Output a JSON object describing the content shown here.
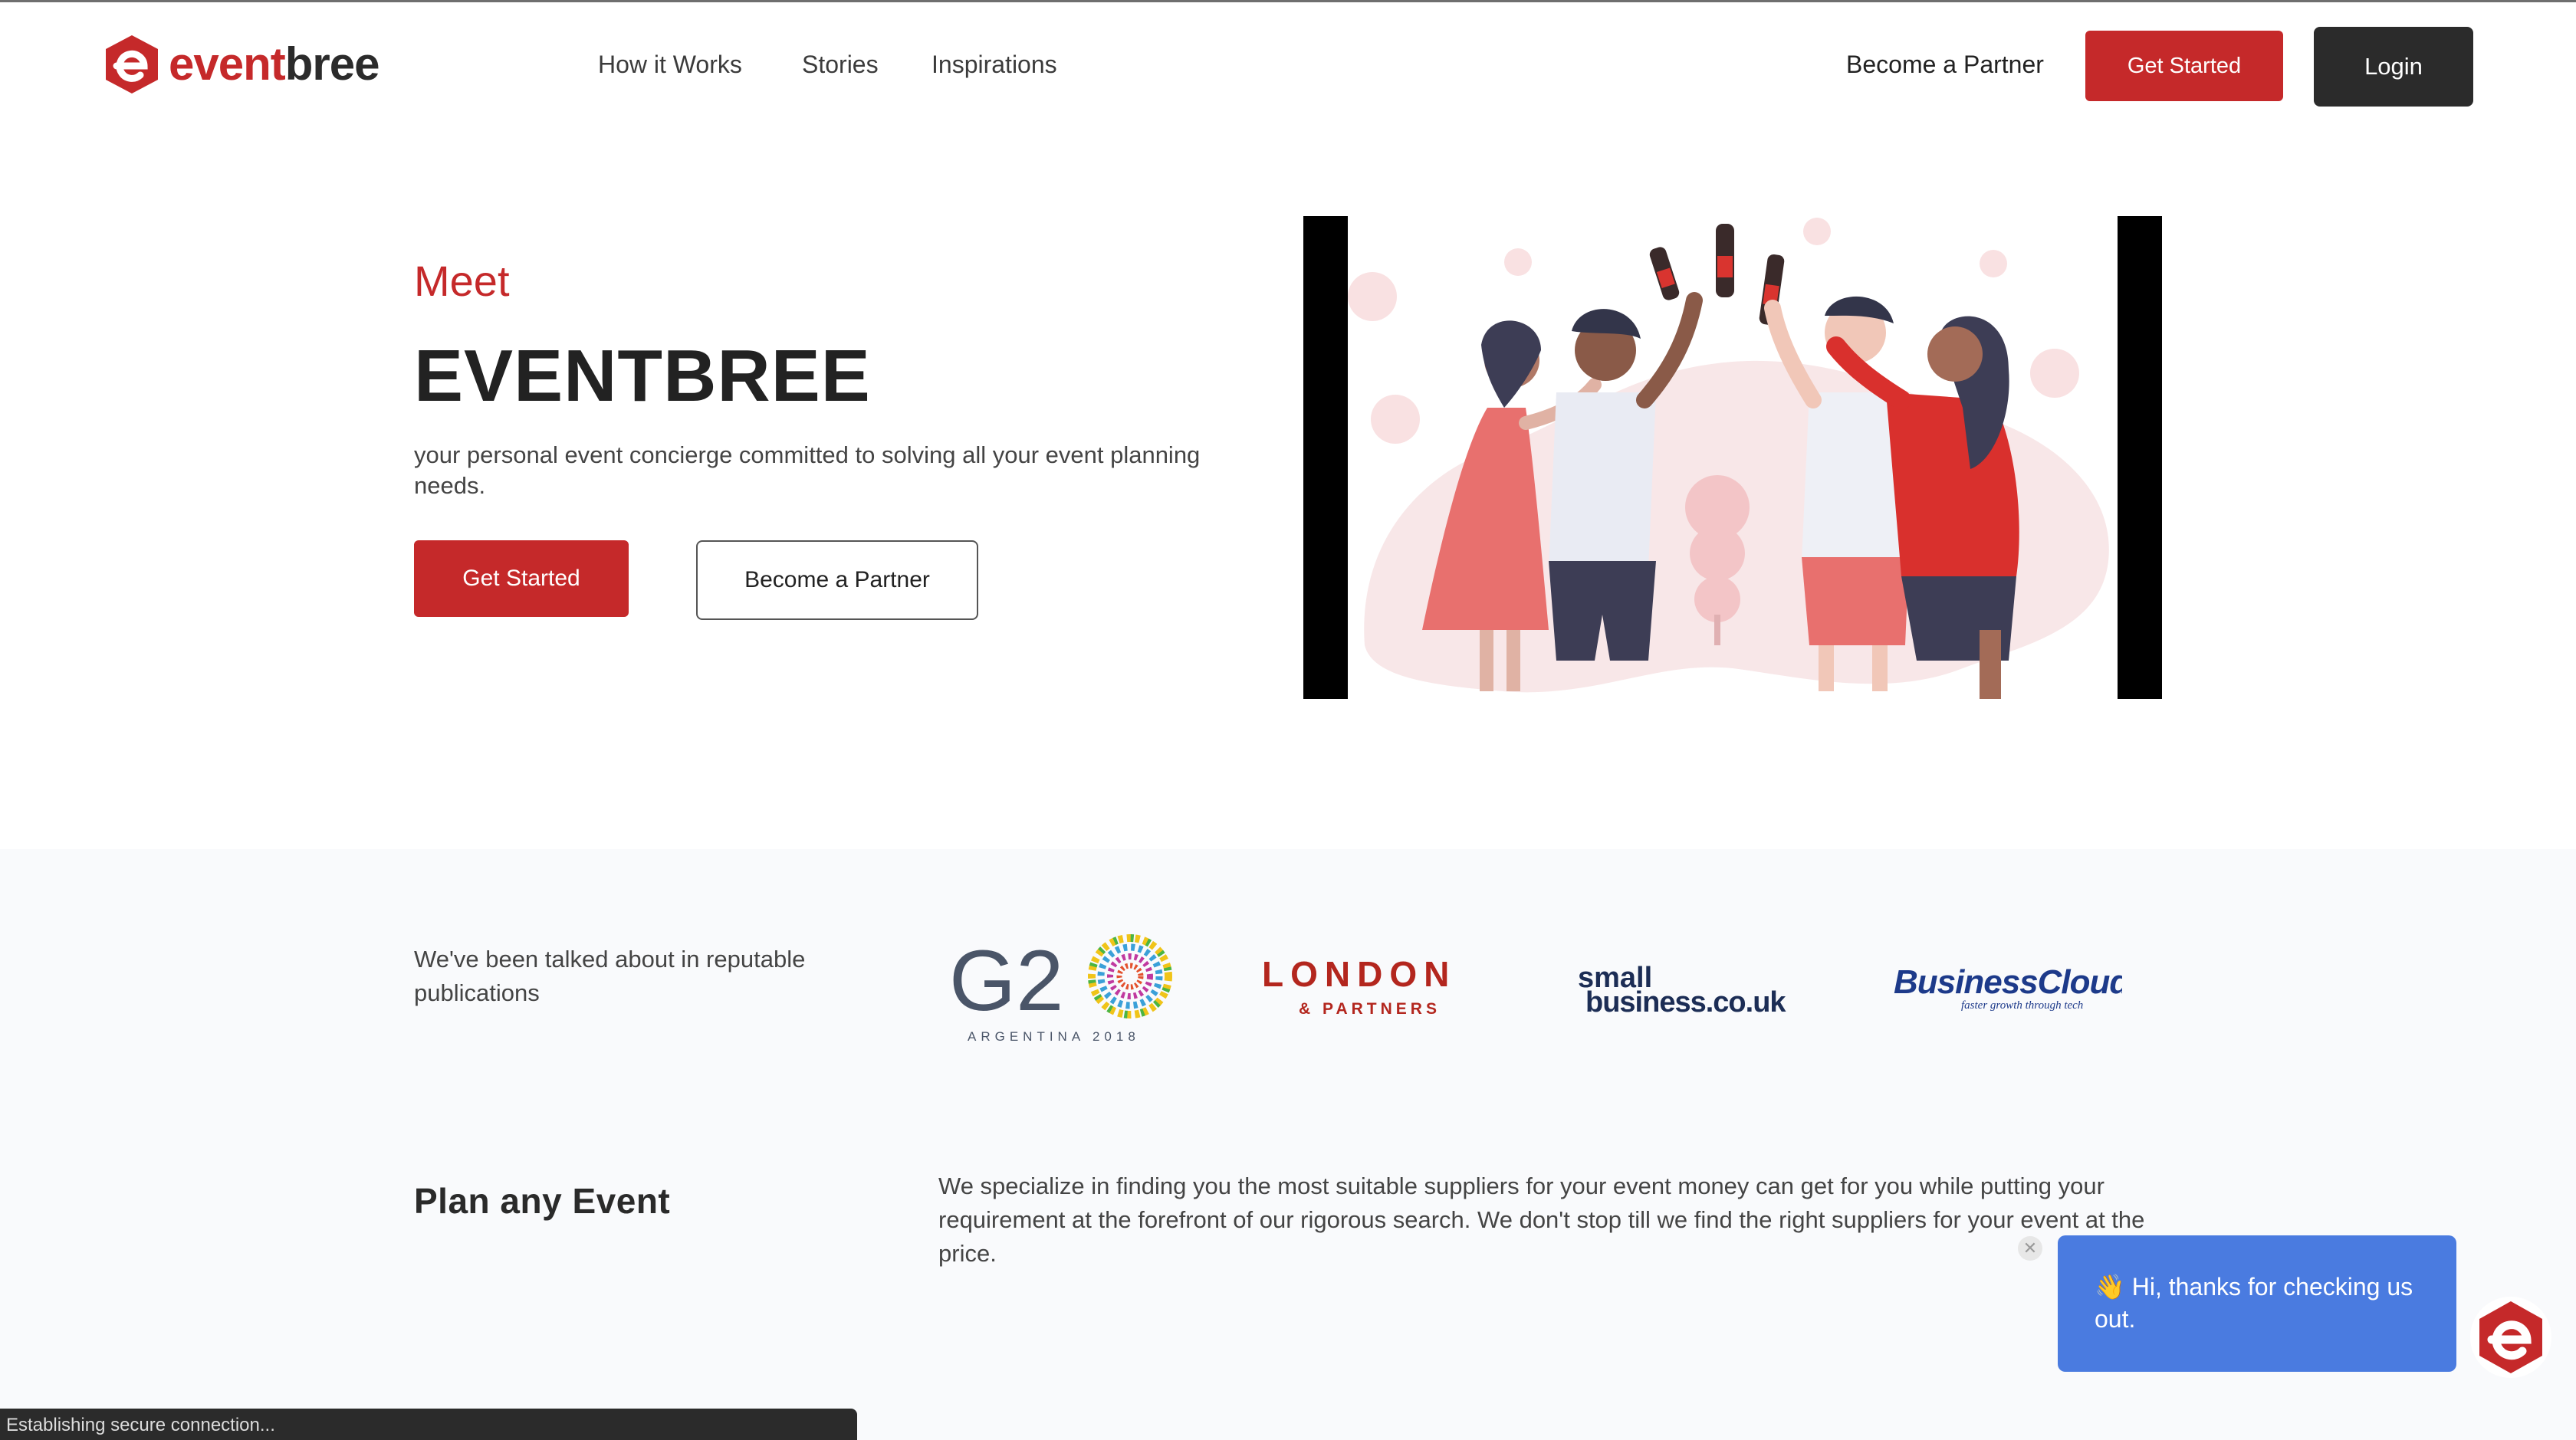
{
  "brand": {
    "name_part1": "event",
    "name_part2": "bree",
    "accent_color": "#c5292a"
  },
  "nav": {
    "links": [
      "How it Works",
      "Stories",
      "Inspirations"
    ],
    "partner_label": "Become a Partner",
    "get_started_label": "Get Started",
    "login_label": "Login"
  },
  "hero": {
    "meet": "Meet",
    "title": "EVENTBREE",
    "subtitle": "your personal event concierge committed to solving all your event planning needs.",
    "get_started_label": "Get Started",
    "partner_label": "Become a Partner"
  },
  "press": {
    "text": "We've been talked about in reputable publications",
    "logos": {
      "g20": {
        "main": "G2",
        "sub": "ARGENTINA 2018"
      },
      "london": {
        "main": "LONDON",
        "sub": "& PARTNERS"
      },
      "smallbiz": {
        "line1": "small",
        "line2": "business.co.uk"
      },
      "bizcloud": {
        "main": "BusinessCloud",
        "sub": "faster growth through tech"
      }
    }
  },
  "plan": {
    "title": "Plan any Event",
    "text": "We specialize in finding you the most suitable suppliers for your event money can get for you while putting your requirement at the forefront of our rigorous search. We don't stop till we find the right suppliers for your event at the price."
  },
  "chat": {
    "emoji": "👋",
    "message": "Hi, thanks for checking us out.",
    "close_glyph": "✕"
  },
  "status": {
    "text": "Establishing secure connection..."
  }
}
